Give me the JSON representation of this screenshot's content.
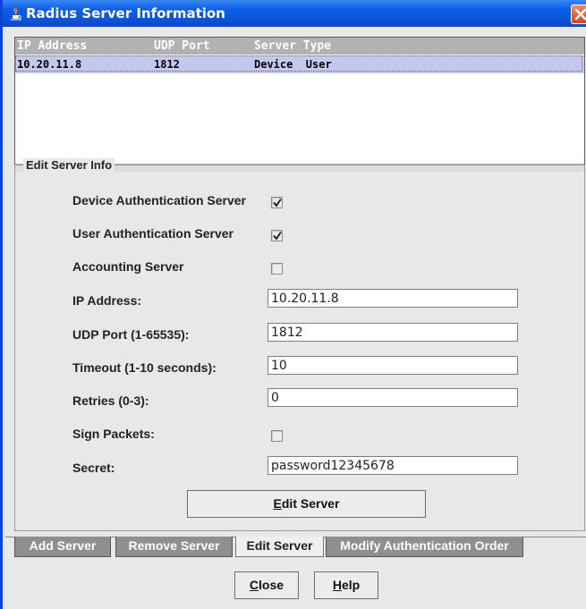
{
  "window": {
    "title": "Radius Server Information",
    "title_icon": "java-coffee-icon",
    "close_icon": "close-icon",
    "titlebar_color": "#0b5ee8"
  },
  "server_table": {
    "columns": [
      "IP Address",
      "UDP Port",
      "Server Type"
    ],
    "rows": [
      [
        "10.20.11.8",
        "1812",
        "Device  User"
      ]
    ],
    "selected_row_color": "#c6c7ef"
  },
  "edit_server_info": {
    "legend": "Edit Server Info",
    "device_auth_label": "Device Authentication Server",
    "device_auth_checked": true,
    "user_auth_label": "User Authentication Server",
    "user_auth_checked": true,
    "accounting_label": "Accounting Server",
    "accounting_checked": false,
    "ip_label": "IP Address:",
    "ip_value": "10.20.11.8",
    "udp_label": "UDP Port (1-65535):",
    "udp_value": "1812",
    "timeout_label": "Timeout (1-10 seconds):",
    "timeout_value": "10",
    "retries_label": "Retries (0-3):",
    "retries_value": "0",
    "sign_label": "Sign Packets:",
    "sign_checked": false,
    "secret_label": "Secret:",
    "secret_value": "password12345678",
    "edit_button": "Edit Server"
  },
  "tabs": [
    {
      "label": "Add Server",
      "active": false
    },
    {
      "label": "Remove Server",
      "active": false
    },
    {
      "label": "Edit Server",
      "active": true
    },
    {
      "label": "Modify Authentication Order",
      "active": false
    }
  ],
  "footer": {
    "close_button": "Close",
    "help_button": "Help"
  }
}
